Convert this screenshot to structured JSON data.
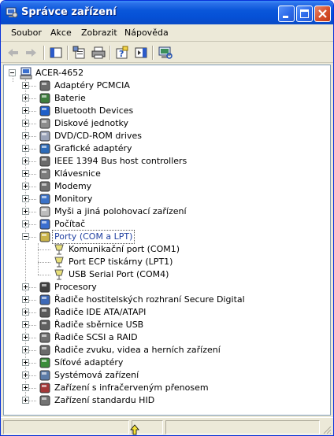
{
  "window": {
    "title": "Správce zařízení",
    "title_icon": "computer-manage-icon"
  },
  "menu": [
    "Soubor",
    "Akce",
    "Zobrazit",
    "Nápověda"
  ],
  "toolbar": {
    "buttons": [
      "back-arrow-icon",
      "forward-arrow-icon",
      "show-hide-tree-icon",
      "properties-icon",
      "print-icon",
      "help-icon",
      "show-hide-action-pane-icon",
      "scan-hardware-icon"
    ]
  },
  "tree": {
    "root": "ACER-4652",
    "categories": [
      {
        "label": "Adaptéry PCMCIA",
        "icon": "pcmcia-icon",
        "expanded": false
      },
      {
        "label": "Baterie",
        "icon": "battery-icon",
        "expanded": false
      },
      {
        "label": "Bluetooth Devices",
        "icon": "bluetooth-icon",
        "expanded": false
      },
      {
        "label": "Diskové jednotky",
        "icon": "disk-drive-icon",
        "expanded": false
      },
      {
        "label": "DVD/CD-ROM drives",
        "icon": "cdrom-icon",
        "expanded": false
      },
      {
        "label": "Grafické adaptéry",
        "icon": "display-adapter-icon",
        "expanded": false
      },
      {
        "label": "IEEE 1394 Bus host controllers",
        "icon": "ieee1394-icon",
        "expanded": false
      },
      {
        "label": "Klávesnice",
        "icon": "keyboard-icon",
        "expanded": false
      },
      {
        "label": "Modemy",
        "icon": "modem-icon",
        "expanded": false
      },
      {
        "label": "Monitory",
        "icon": "monitor-icon",
        "expanded": false
      },
      {
        "label": "Myši a jiná polohovací zařízení",
        "icon": "mouse-icon",
        "expanded": false
      },
      {
        "label": "Počítač",
        "icon": "computer-icon",
        "expanded": false
      },
      {
        "label": "Porty (COM a LPT)",
        "icon": "port-icon",
        "expanded": true,
        "selected": true,
        "children": [
          "Komunikační port (COM1)",
          "Port ECP tiskárny (LPT1)",
          "USB Serial Port (COM4)"
        ]
      },
      {
        "label": "Procesory",
        "icon": "processor-icon",
        "expanded": false
      },
      {
        "label": "Řadiče hostitelských rozhraní Secure Digital",
        "icon": "sd-host-icon",
        "expanded": false
      },
      {
        "label": "Řadiče IDE ATA/ATAPI",
        "icon": "ide-controller-icon",
        "expanded": false
      },
      {
        "label": "Řadiče sběrnice USB",
        "icon": "usb-controller-icon",
        "expanded": false
      },
      {
        "label": "Řadiče SCSI a RAID",
        "icon": "scsi-controller-icon",
        "expanded": false
      },
      {
        "label": "Řadiče zvuku, videa a herních zařízení",
        "icon": "sound-icon",
        "expanded": false
      },
      {
        "label": "Síťové adaptéry",
        "icon": "network-adapter-icon",
        "expanded": false
      },
      {
        "label": "Systémová zařízení",
        "icon": "system-devices-icon",
        "expanded": false
      },
      {
        "label": "Zařízení s infračerveným přenosem",
        "icon": "infrared-icon",
        "expanded": false
      },
      {
        "label": "Zařízení standardu HID",
        "icon": "hid-icon",
        "expanded": false
      }
    ]
  }
}
